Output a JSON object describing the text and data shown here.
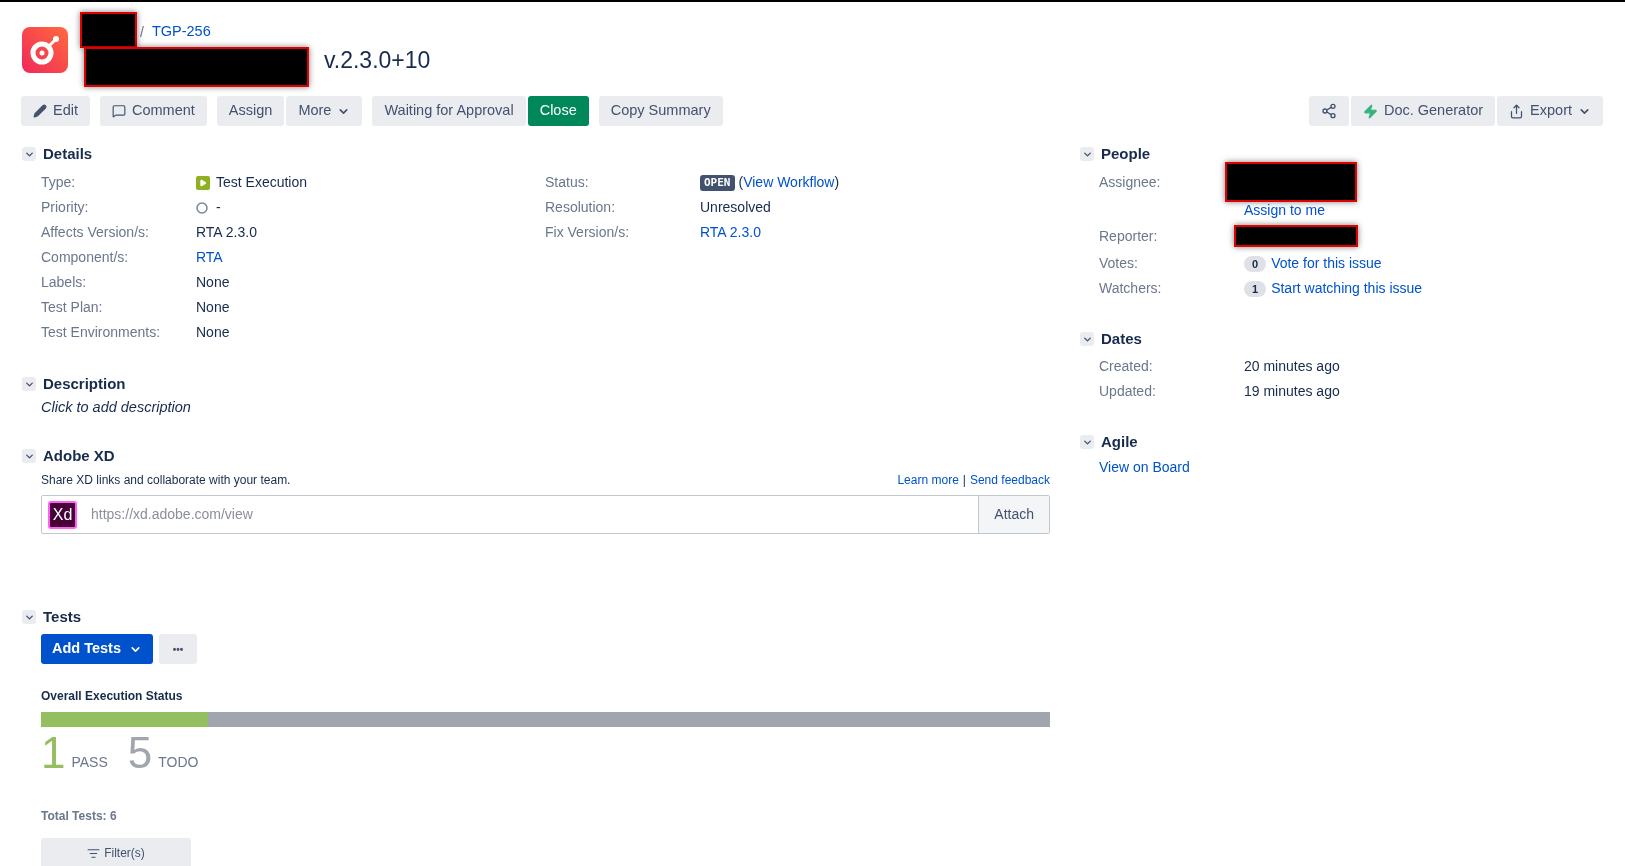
{
  "header": {
    "breadcrumb": {
      "separator": "/",
      "issue_key": "TGP-256"
    },
    "title": "v.2.3.0+10"
  },
  "toolbar": {
    "groups": [
      [
        {
          "label": "Edit",
          "kind": "pencil"
        }
      ],
      [
        {
          "label": "Comment",
          "kind": "speech"
        }
      ],
      [
        {
          "label": "Assign",
          "kind": "plain"
        },
        {
          "label": "More",
          "kind": "menu"
        }
      ],
      [
        {
          "label": "Waiting for Approval",
          "kind": "plain"
        },
        {
          "label": "Close",
          "kind": "primary"
        }
      ],
      [
        {
          "label": "Copy Summary",
          "kind": "plain"
        }
      ]
    ],
    "right": [
      {
        "kind": "share"
      },
      {
        "label": "Doc. Generator",
        "kind": "bolt"
      },
      {
        "label": "Export",
        "kind": "export"
      }
    ]
  },
  "details": {
    "title": "Details",
    "expanded": true,
    "left": [
      {
        "label": "Type:",
        "value": "Test Execution",
        "kind": "type"
      },
      {
        "label": "Priority:",
        "value": "-",
        "kind": "priority"
      },
      {
        "label": "Affects Version/s:",
        "value": "RTA 2.3.0",
        "kind": "text"
      },
      {
        "label": "Component/s:",
        "value": "RTA",
        "kind": "link"
      },
      {
        "label": "Labels:",
        "value": "None",
        "kind": "text"
      },
      {
        "label": "Test Plan:",
        "value": "None",
        "kind": "text"
      },
      {
        "label": "Test Environments:",
        "value": "None",
        "kind": "text"
      }
    ],
    "right": [
      {
        "label": "Status:",
        "value": "OPEN",
        "paren_open": "(",
        "link": "View Workflow",
        "paren_close": ")",
        "kind": "status"
      },
      {
        "label": "Resolution:",
        "value": "Unresolved",
        "kind": "text"
      },
      {
        "label": "Fix Version/s:",
        "value": "RTA 2.3.0",
        "kind": "link"
      }
    ]
  },
  "description": {
    "title": "Description",
    "expanded": true,
    "placeholder": "Click to add description"
  },
  "adobe_xd": {
    "title": "Adobe XD",
    "expanded": true,
    "intro": "Share XD links and collaborate with your team.",
    "links": [
      "Learn more",
      "Send feedback"
    ],
    "separator": "|",
    "logo": "Xd",
    "url_placeholder": "https://xd.adobe.com/view",
    "attach": "Attach"
  },
  "tests": {
    "title": "Tests",
    "expanded": true,
    "add_button": "Add Tests",
    "more_button": "•••",
    "status_title": "Overall Execution Status",
    "segments": [
      {
        "count": "1",
        "label": "PASS",
        "level": 0.166,
        "color": "#94bf61"
      },
      {
        "count": "5",
        "label": "TODO",
        "level": 0.834,
        "color": "#a1a5ad"
      }
    ],
    "total": "Total Tests: 6",
    "filter": "Filter(s)"
  },
  "people": {
    "title": "People",
    "expanded": true,
    "assignee_label": "Assignee:",
    "assign_to_me": "Assign to me",
    "reporter_label": "Reporter:",
    "votes": {
      "label": "Votes:",
      "count": "0",
      "link": "Vote for this issue"
    },
    "watchers": {
      "label": "Watchers:",
      "count": "1",
      "link": "Start watching this issue"
    }
  },
  "dates": {
    "title": "Dates",
    "expanded": true,
    "rows": [
      {
        "label": "Created:",
        "value": "20 minutes ago"
      },
      {
        "label": "Updated:",
        "value": "19 minutes ago"
      }
    ]
  },
  "agile": {
    "title": "Agile",
    "expanded": true,
    "link": "View on Board"
  }
}
